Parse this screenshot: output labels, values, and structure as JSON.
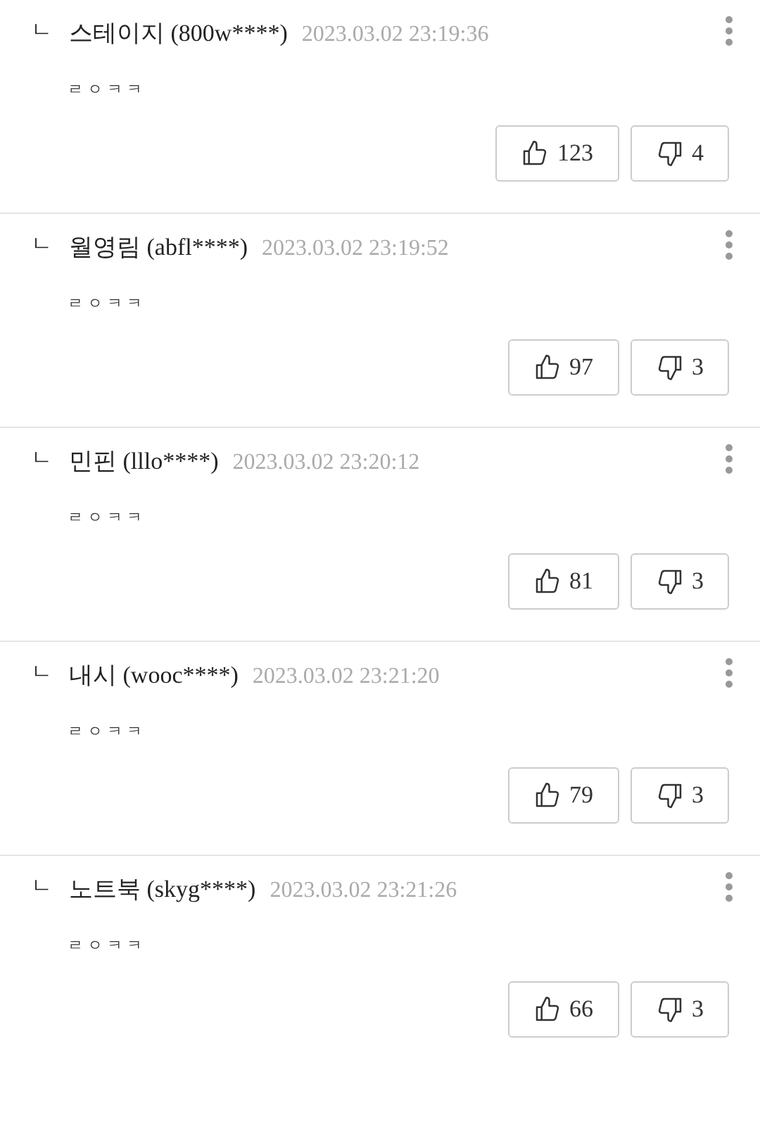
{
  "replies": [
    {
      "marker": "ㄴ",
      "nickname": "스테이지 (800w****)",
      "date": "2023.03.02 23:19:36",
      "text": "ㄹㅇㅋㅋ",
      "likes": "123",
      "dislikes": "4"
    },
    {
      "marker": "ㄴ",
      "nickname": "월영림 (abfl****)",
      "date": "2023.03.02 23:19:52",
      "text": "ㄹㅇㅋㅋ",
      "likes": "97",
      "dislikes": "3"
    },
    {
      "marker": "ㄴ",
      "nickname": "민핀 (lllo****)",
      "date": "2023.03.02 23:20:12",
      "text": "ㄹㅇㅋㅋ",
      "likes": "81",
      "dislikes": "3"
    },
    {
      "marker": "ㄴ",
      "nickname": "내시 (wooc****)",
      "date": "2023.03.02 23:21:20",
      "text": "ㄹㅇㅋㅋ",
      "likes": "79",
      "dislikes": "3"
    },
    {
      "marker": "ㄴ",
      "nickname": "노트북 (skyg****)",
      "date": "2023.03.02 23:21:26",
      "text": "ㄹㅇㅋㅋ",
      "likes": "66",
      "dislikes": "3"
    }
  ]
}
